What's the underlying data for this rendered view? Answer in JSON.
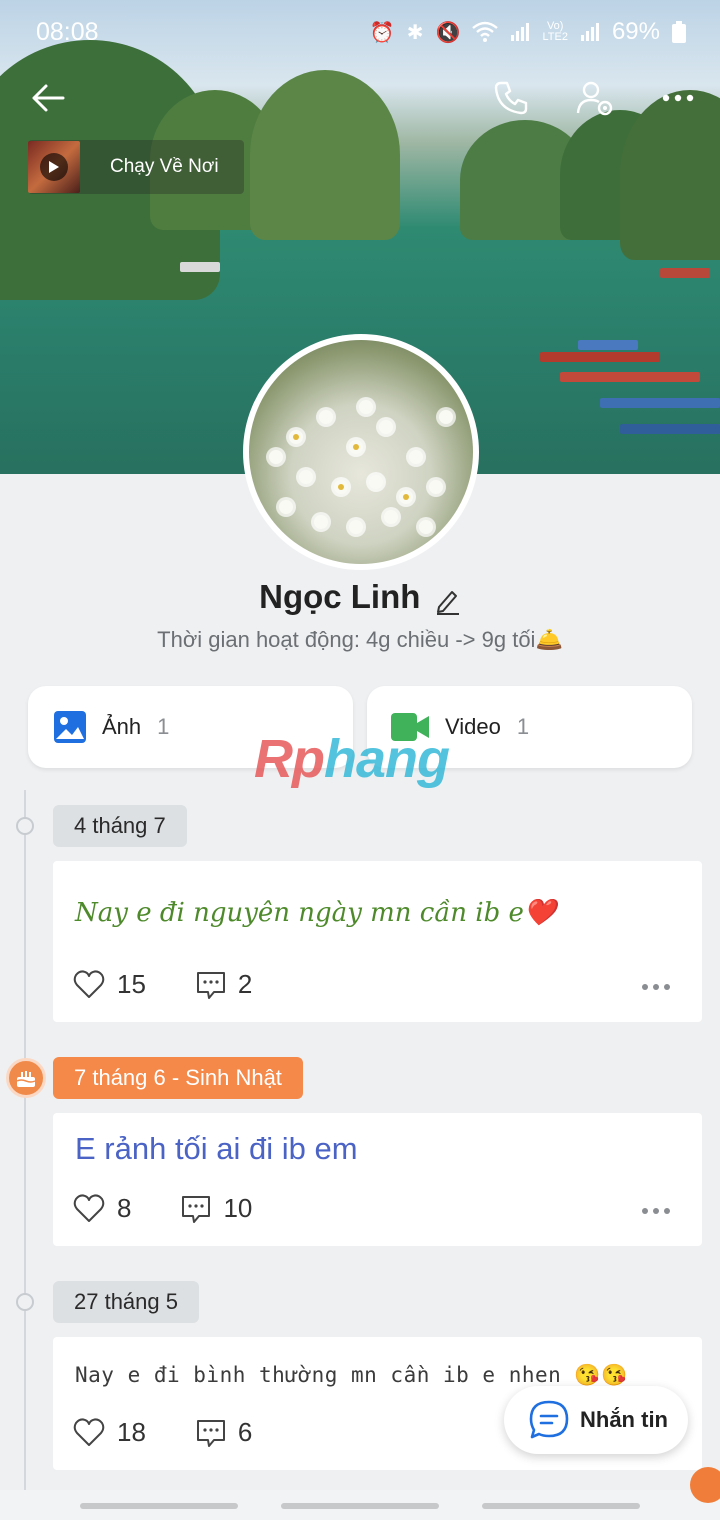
{
  "status_bar": {
    "time": "08:08",
    "battery": "69%",
    "icons": [
      "alarm-icon",
      "bluetooth-icon",
      "mute-icon",
      "wifi-icon",
      "signal-icon",
      "volte-icon",
      "signal-icon",
      "battery-icon"
    ]
  },
  "header": {
    "back_icon": "back-arrow-icon",
    "call_icon": "phone-icon",
    "settings_icon": "user-settings-icon",
    "more_icon": "more-icon"
  },
  "music": {
    "title": "Chạy Về Nơi"
  },
  "profile": {
    "name": "Ngọc Linh",
    "bio": "Thời gian hoạt động: 4g chiều -> 9g tối🛎️"
  },
  "media": {
    "photos": {
      "label": "Ảnh",
      "count": "1",
      "icon": "image-icon"
    },
    "videos": {
      "label": "Video",
      "count": "1",
      "icon": "video-icon"
    }
  },
  "watermark": {
    "part1": "Rp",
    "part2": "hang"
  },
  "posts": [
    {
      "date": "4 tháng 7",
      "text": "Nay e đi nguyên ngày mn cần ib e❤️",
      "likes": "15",
      "comments": "2"
    },
    {
      "date": "7 tháng 6 - Sinh Nhật",
      "text": "E rảnh tối ai đi ib em",
      "likes": "8",
      "comments": "10"
    },
    {
      "date": "27 tháng 5",
      "text": "Nay e đi bình thường mn cần ib e nhen 😘😘",
      "likes": "18",
      "comments": "6"
    }
  ],
  "fab": {
    "label": "Nhắn tin"
  },
  "colors": {
    "accent": "#0068ff",
    "birthday": "#f4894a",
    "post1_text": "#4e8a2c",
    "post2_text": "#4b63c4"
  }
}
